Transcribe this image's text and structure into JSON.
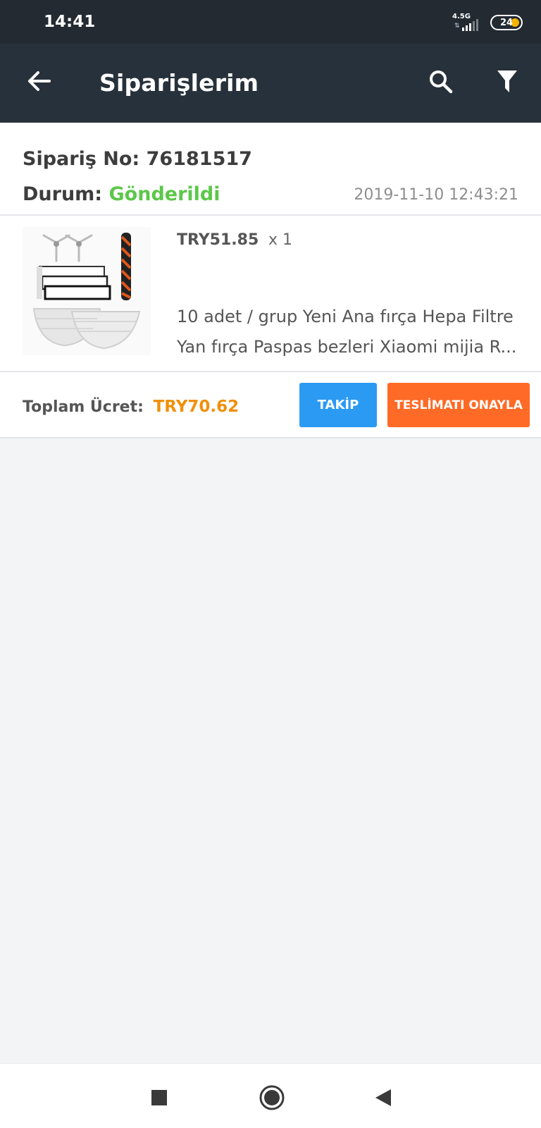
{
  "status_bar": {
    "time": "14:41",
    "network": "4.5G",
    "battery": "24"
  },
  "app_bar": {
    "title": "Siparişlerim",
    "icons": [
      "arrow-left-icon",
      "search-icon",
      "filter-icon"
    ]
  },
  "order": {
    "number_label": "Sipariş No:",
    "number": "76181517",
    "status_label": "Durum:",
    "status": "Gönderildi",
    "date": "2019-11-10 12:43:21",
    "item": {
      "price": "TRY51.85",
      "quantity": "x 1",
      "title": "10 adet / grup Yeni Ana fırça Hepa Filtre Yan fırça Paspas bezleri Xiaomi mijia R..."
    },
    "total_label": "Toplam Ücret:",
    "total": "TRY70.62",
    "track_button": "TAKİP",
    "confirm_button": "TESLİMATI ONAYLA"
  },
  "colors": {
    "app_bar": "#27313b",
    "status_ok": "#5cc74a",
    "price_accent": "#f0900a",
    "track_button": "#2b9af3",
    "confirm_button": "#ff6a26"
  },
  "nav_bar": {
    "icons": [
      "recents-square-icon",
      "home-circle-icon",
      "back-triangle-icon"
    ]
  }
}
